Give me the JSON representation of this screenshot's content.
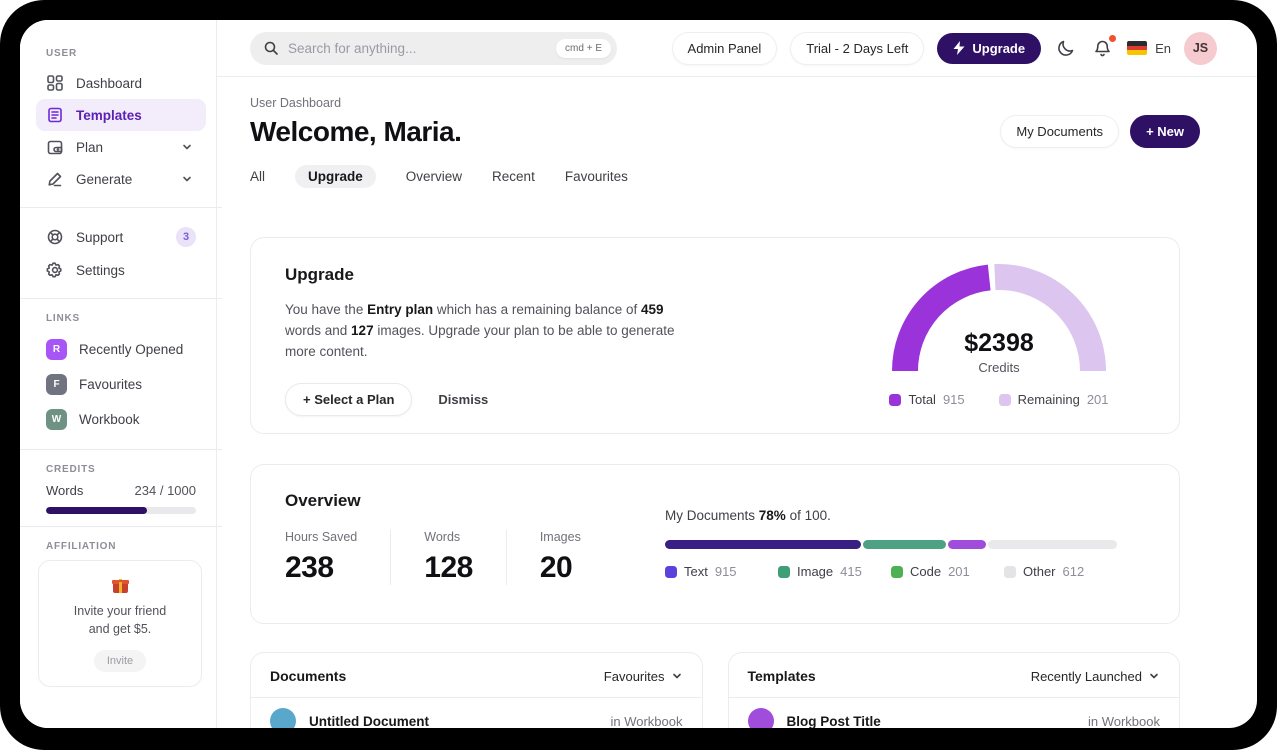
{
  "topbar": {
    "search": {
      "placeholder": "Search for anything...",
      "shortcut": "cmd + E"
    },
    "admin_panel": "Admin Panel",
    "trial": "Trial - 2 Days Left",
    "upgrade": "Upgrade",
    "language": "En",
    "avatar_initials": "JS"
  },
  "sidebar": {
    "sections": {
      "user": "USER",
      "links": "LINKS",
      "credits": "CREDITS",
      "affiliation": "AFFILIATION"
    },
    "nav": [
      {
        "label": "Dashboard"
      },
      {
        "label": "Templates"
      },
      {
        "label": "Plan"
      },
      {
        "label": "Generate"
      }
    ],
    "secondary": [
      {
        "label": "Support",
        "badge": "3"
      },
      {
        "label": "Settings"
      }
    ],
    "links": [
      {
        "label": "Recently Opened",
        "letter": "R",
        "color": "#a855f7"
      },
      {
        "label": "Favourites",
        "letter": "F",
        "color": "#6f7480"
      },
      {
        "label": "Workbook",
        "letter": "W",
        "color": "#6e9384"
      }
    ],
    "credits": {
      "label": "Words",
      "value": "234 / 1000",
      "fill_percent": 67,
      "fill_color": "#2e1065"
    },
    "affiliation": {
      "line1": "Invite your friend",
      "line2": "and get $5.",
      "button": "Invite"
    }
  },
  "page": {
    "breadcrumb": "User Dashboard",
    "title": "Welcome, Maria.",
    "my_documents_button": "My Documents",
    "new_button": "+  New",
    "tabs": [
      {
        "label": "All"
      },
      {
        "label": "Upgrade"
      },
      {
        "label": "Overview"
      },
      {
        "label": "Recent"
      },
      {
        "label": "Favourites"
      }
    ]
  },
  "upgrade_card": {
    "title": "Upgrade",
    "body": {
      "p1": "You have the ",
      "b1": "Entry plan",
      "p2": " which has a remaining balance of ",
      "b2": "459",
      "p3": " words and ",
      "b3": "127",
      "p4": " images. Upgrade your plan to be able to generate more content."
    },
    "select_plan_button": "+ Select a Plan",
    "dismiss_button": "Dismiss",
    "gauge": {
      "center_value": "$2398",
      "center_label": "Credits",
      "legend": [
        {
          "name": "Total",
          "value": "915",
          "color": "#9a33da"
        },
        {
          "name": "Remaining",
          "value": "201",
          "color": "#dcc6f0"
        }
      ]
    }
  },
  "overview_card": {
    "title": "Overview",
    "stats": [
      {
        "label": "Hours Saved",
        "value": "238"
      },
      {
        "label": "Words",
        "value": "128"
      },
      {
        "label": "Images",
        "value": "20"
      }
    ],
    "progress": {
      "p1": "My Documents ",
      "b1": "78%",
      "p2": " of 100."
    },
    "bar": {
      "segments": [
        {
          "name": "Text",
          "value": "915",
          "percent": 43.4,
          "color": "#371f83",
          "legend_color": "#5a43dd"
        },
        {
          "name": "Image",
          "value": "415",
          "percent": 18.3,
          "color": "#4ea284",
          "legend_color": "#3f9e77"
        },
        {
          "name": "Code",
          "value": "201",
          "percent": 8.4,
          "color": "#a04ddb",
          "legend_color": "#4db052"
        },
        {
          "name": "Other",
          "value": "612",
          "percent": 28,
          "color": "#e9e9ec",
          "legend_color": "#e4e4e7"
        }
      ]
    }
  },
  "documents_card": {
    "title": "Documents",
    "filter": "Favourites",
    "rows": [
      {
        "title": "Untitled Document",
        "location": "in Workbook",
        "color": "#5aa7cc"
      }
    ]
  },
  "templates_card": {
    "title": "Templates",
    "filter": "Recently Launched",
    "rows": [
      {
        "title": "Blog Post Title",
        "location": "in Workbook",
        "color": "#a04ddb"
      }
    ]
  },
  "chart_data": [
    {
      "type": "pie",
      "variant": "semicircle-donut",
      "title": "Credits",
      "center_label": "$2398",
      "center_sublabel": "Credits",
      "series": [
        {
          "name": "Total",
          "value": 915
        },
        {
          "name": "Remaining",
          "value": 201
        }
      ],
      "colors": [
        "#9a33da",
        "#dcc6f0"
      ],
      "legend_position": "bottom"
    },
    {
      "type": "bar",
      "variant": "stacked-progress",
      "title": "My Documents 78% of 100.",
      "series": [
        {
          "name": "Text",
          "value": 915
        },
        {
          "name": "Image",
          "value": 415
        },
        {
          "name": "Code",
          "value": 201
        },
        {
          "name": "Other",
          "value": 612
        }
      ],
      "colors": [
        "#371f83",
        "#4ea284",
        "#a04ddb",
        "#e9e9ec"
      ],
      "legend_position": "bottom"
    }
  ]
}
